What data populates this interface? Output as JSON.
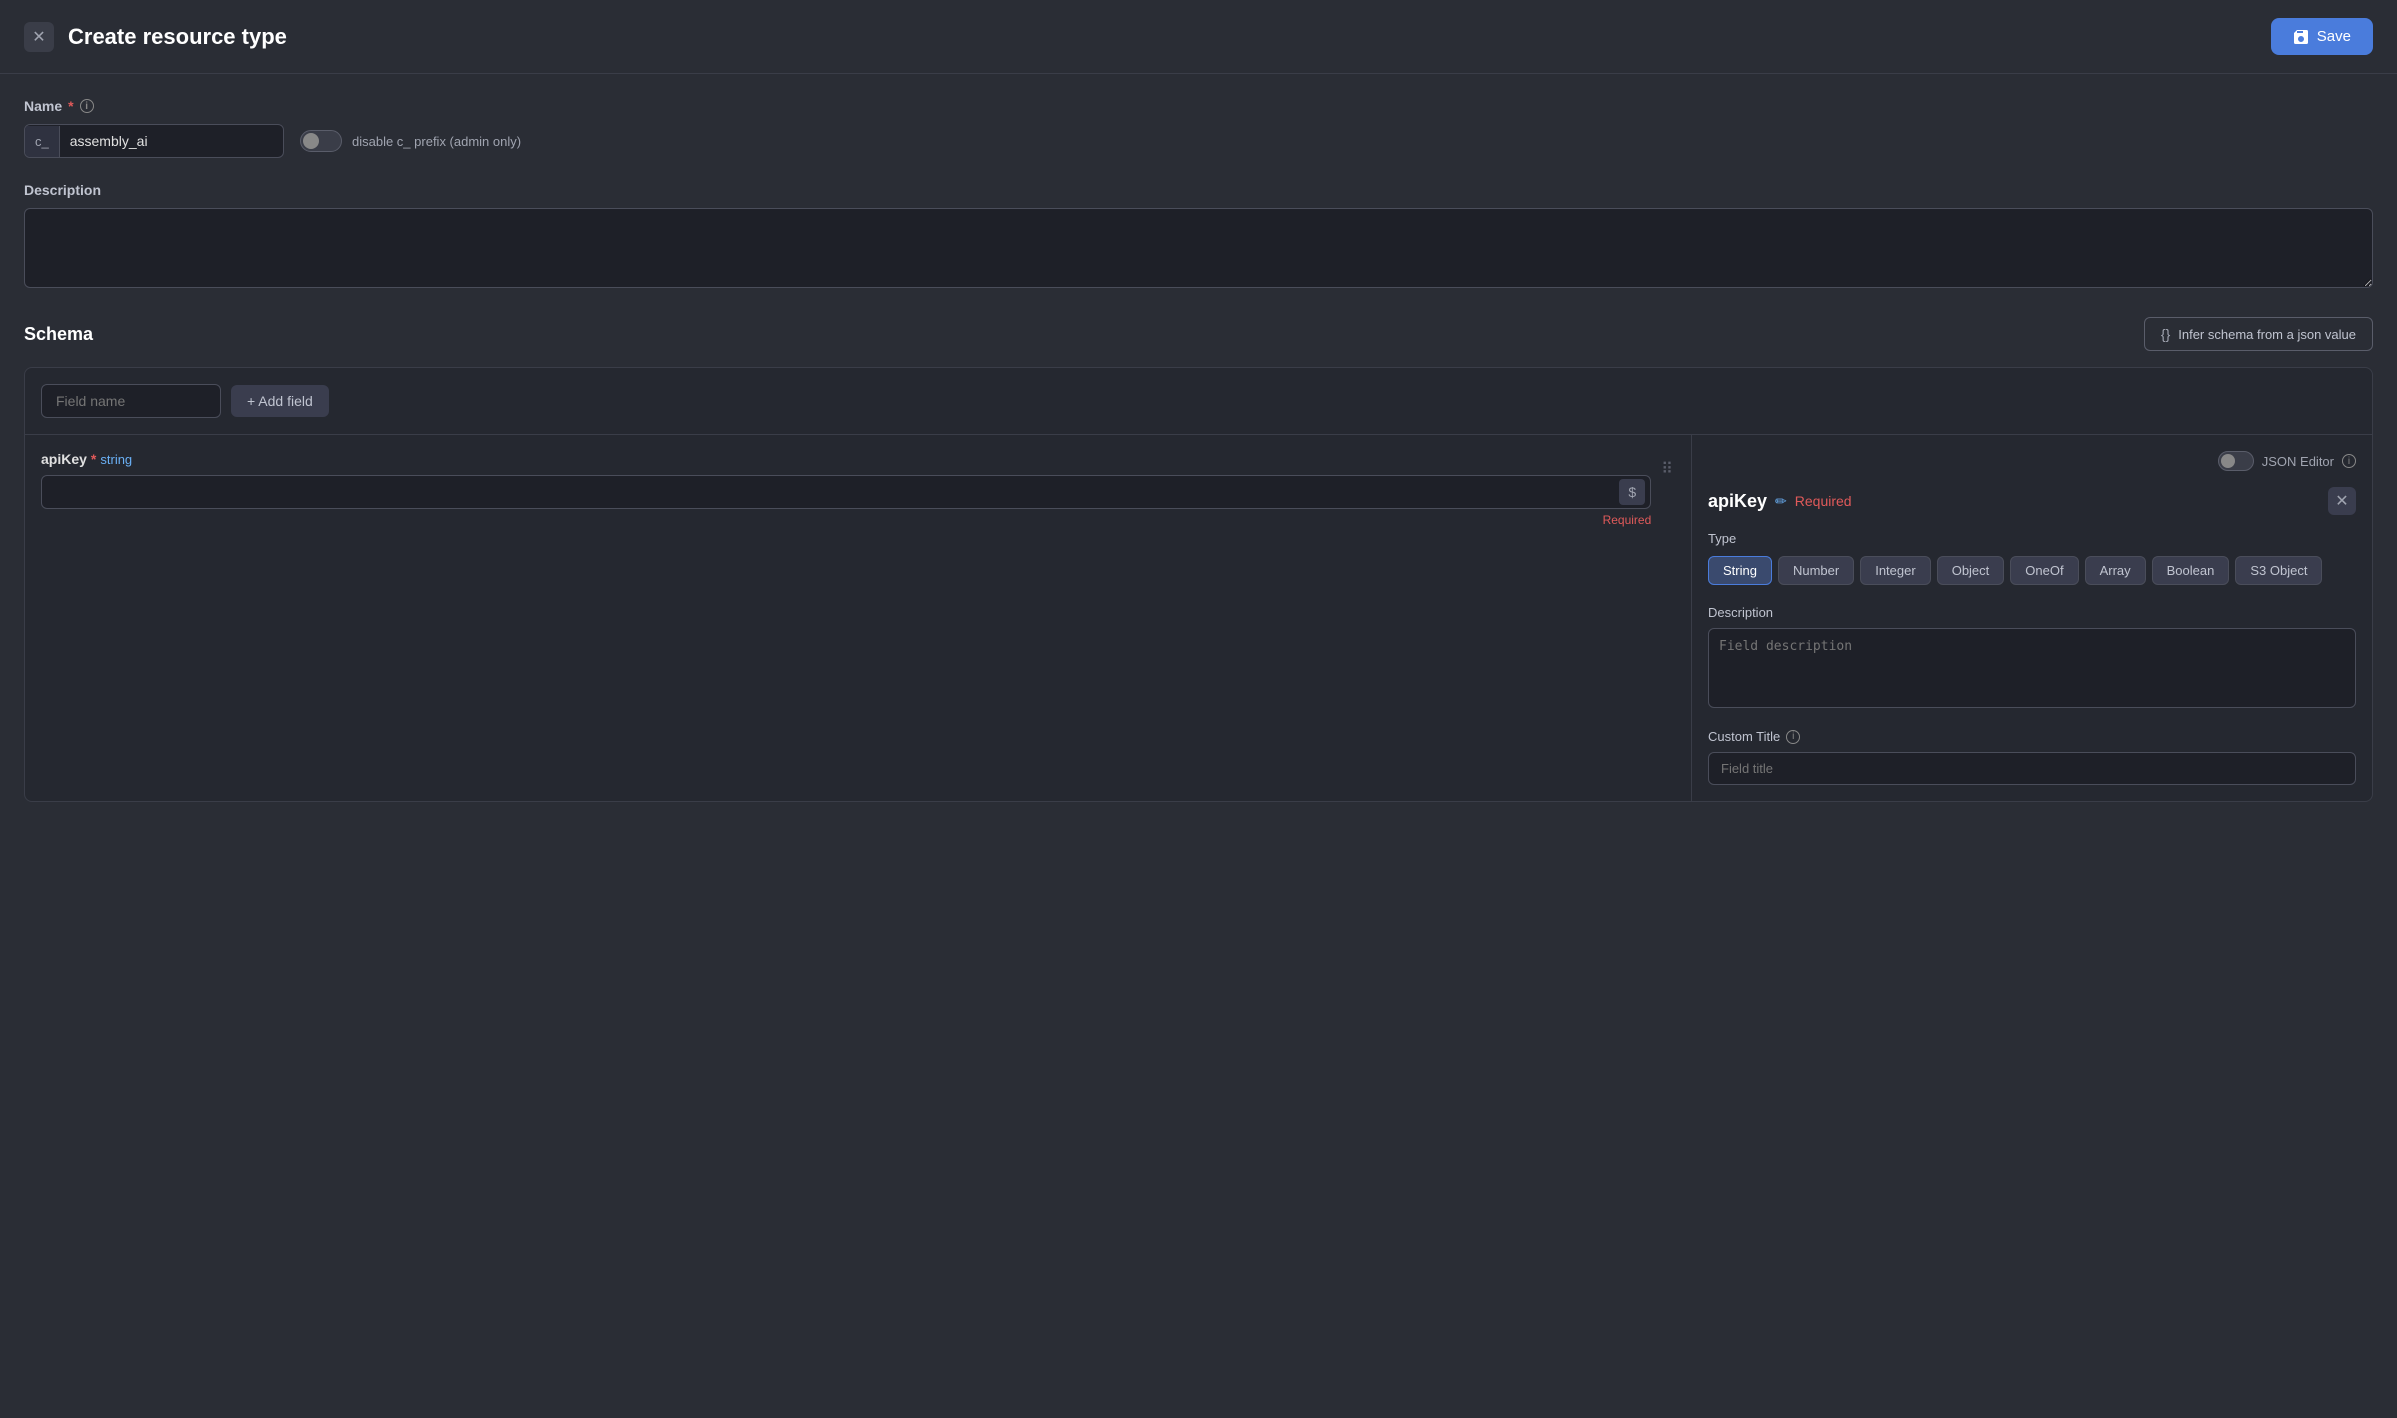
{
  "header": {
    "title": "Create resource type",
    "save_label": "Save"
  },
  "name_section": {
    "label": "Name",
    "prefix": "c_",
    "value": "assembly_ai",
    "placeholder": "",
    "toggle_label": "disable c_ prefix (admin only)"
  },
  "description_section": {
    "label": "Description",
    "placeholder": ""
  },
  "schema_section": {
    "label": "Schema",
    "infer_btn_label": "Infer schema from a json value",
    "field_name_placeholder": "Field name",
    "add_field_label": "+ Add field"
  },
  "api_key_field": {
    "name": "apiKey",
    "required_star": "*",
    "type_badge": "string",
    "value": "",
    "dollar_btn": "$",
    "required_text": "Required"
  },
  "right_panel": {
    "json_editor_label": "JSON Editor",
    "field_name": "apiKey",
    "required_label": "Required",
    "type_label": "Type",
    "type_buttons": [
      {
        "label": "String",
        "active": true
      },
      {
        "label": "Number",
        "active": false
      },
      {
        "label": "Integer",
        "active": false
      },
      {
        "label": "Object",
        "active": false
      },
      {
        "label": "OneOf",
        "active": false
      },
      {
        "label": "Array",
        "active": false
      },
      {
        "label": "Boolean",
        "active": false
      },
      {
        "label": "S3 Object",
        "active": false
      }
    ],
    "description_label": "Description",
    "description_placeholder": "Field description",
    "custom_title_label": "Custom Title",
    "field_title_placeholder": "Field title"
  }
}
